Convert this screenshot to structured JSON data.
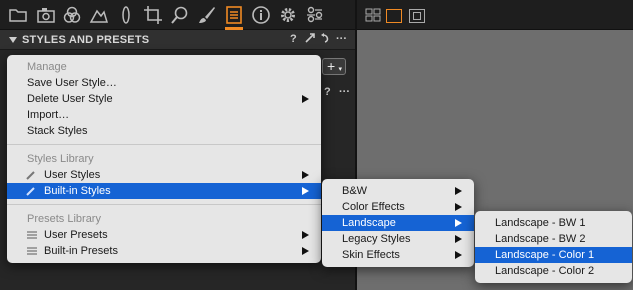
{
  "toolbar": {
    "tools": [
      {
        "icon": "folder-icon"
      },
      {
        "icon": "camera-icon"
      },
      {
        "icon": "color-circles-icon"
      },
      {
        "icon": "exposure-icon"
      },
      {
        "icon": "lens-icon"
      },
      {
        "icon": "crop-icon"
      },
      {
        "icon": "search-icon"
      },
      {
        "icon": "brush-icon"
      },
      {
        "icon": "styles-list-icon",
        "active": true
      },
      {
        "icon": "info-icon"
      },
      {
        "icon": "gear-icon"
      },
      {
        "icon": "batch-icon"
      }
    ],
    "accent_color": "#f08a24"
  },
  "panel": {
    "title": "STYLES AND PRESETS",
    "help": "?",
    "more": "···",
    "add": "+",
    "sub_help": "?",
    "sub_more": "···"
  },
  "menu_main": {
    "manage_header": "Manage",
    "save_user_style": "Save User Style…",
    "delete_user_style": "Delete User Style",
    "import": "Import…",
    "stack_styles": "Stack Styles",
    "styles_library_header": "Styles Library",
    "user_styles": "User Styles",
    "built_in_styles": "Built-in Styles",
    "presets_library_header": "Presets Library",
    "user_presets": "User Presets",
    "built_in_presets": "Built-in Presets"
  },
  "menu_builtin": {
    "items": [
      "B&W",
      "Color Effects",
      "Landscape",
      "Legacy Styles",
      "Skin Effects"
    ],
    "highlighted": "Landscape"
  },
  "menu_landscape": {
    "items": [
      "Landscape - BW 1",
      "Landscape - BW 2",
      "Landscape - Color 1",
      "Landscape - Color 2"
    ],
    "highlighted": "Landscape - Color 1"
  },
  "highlight_color": "#1563d4"
}
